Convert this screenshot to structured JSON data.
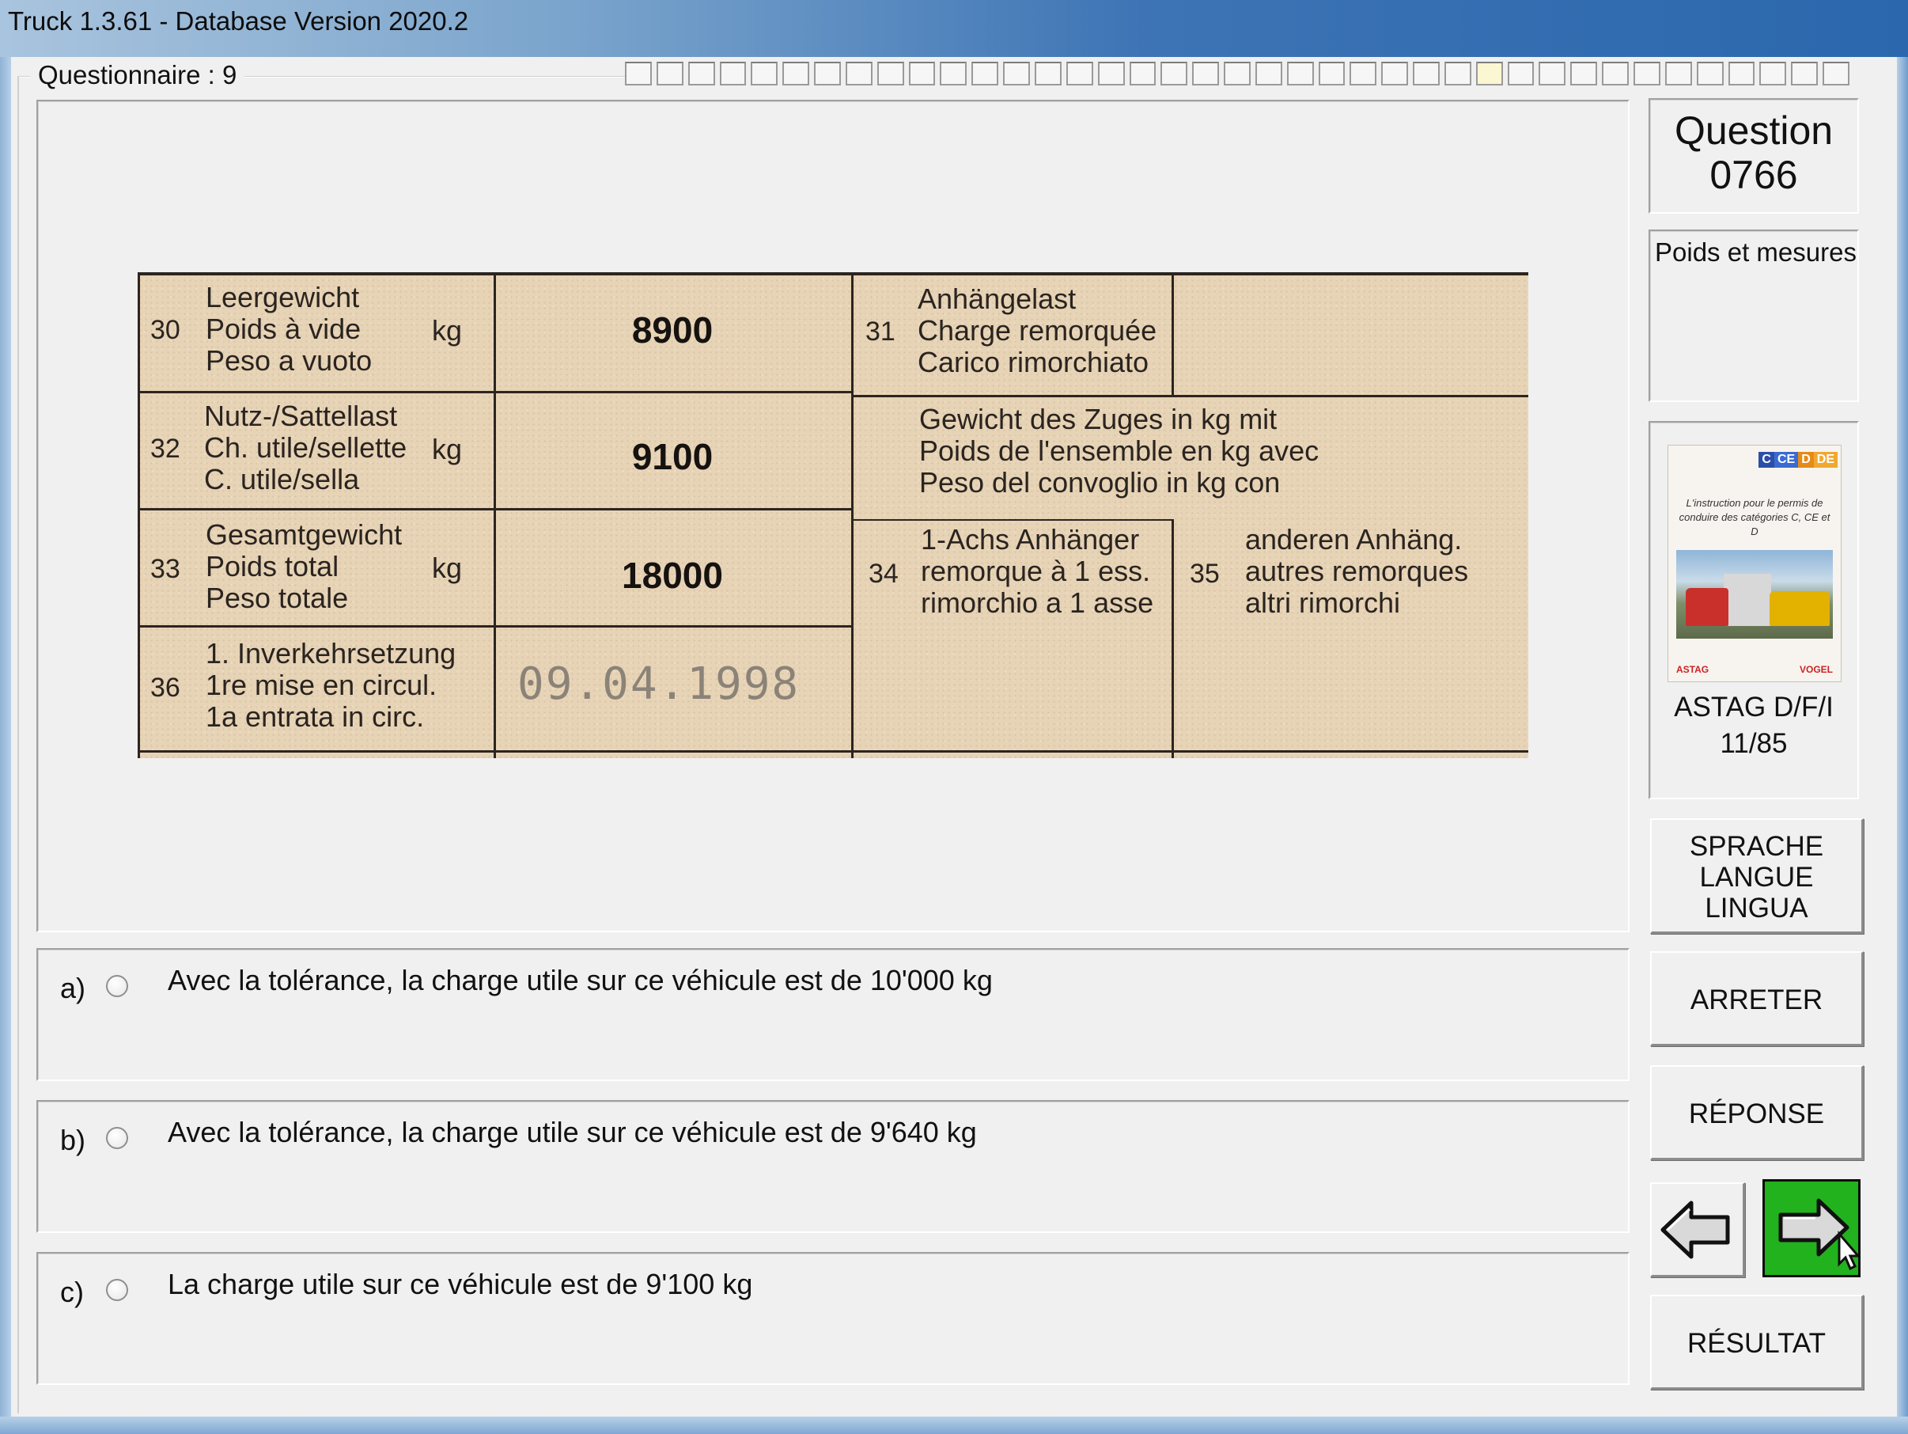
{
  "window": {
    "title": "Truck 1.3.61 - Database Version 2020.2"
  },
  "questionnaire": {
    "label": "Questionnaire : 9",
    "progress_total": 39,
    "progress_current": 28
  },
  "question": {
    "label": "Question",
    "number": "0766",
    "category": "Poids et mesures"
  },
  "document": {
    "rows": [
      {
        "num": "30",
        "lines": [
          "Leergewicht",
          "Poids à vide",
          "Peso a vuoto"
        ],
        "unit": "kg",
        "value": "8900"
      },
      {
        "num": "32",
        "lines": [
          "Nutz-/Sattellast",
          "Ch. utile/sellette",
          "C. utile/sella"
        ],
        "unit": "kg",
        "value": "9100"
      },
      {
        "num": "33",
        "lines": [
          "Gesamtgewicht",
          "Poids total",
          "Peso totale"
        ],
        "unit": "kg",
        "value": "18000"
      },
      {
        "num": "36",
        "lines": [
          "1. Inverkehrsetzung",
          "1re mise en circul.",
          "1a entrata in circ."
        ],
        "unit": "",
        "value": "09.04.1998"
      }
    ],
    "field31": {
      "num": "31",
      "lines": [
        "Anhängelast",
        "Charge remorquée",
        "Carico rimorchiato"
      ]
    },
    "combination": {
      "lines": [
        "Gewicht des Zuges in kg mit",
        "Poids de l'ensemble en kg avec",
        "Peso del convoglio in kg con"
      ]
    },
    "field34": {
      "num": "34",
      "lines": [
        "1-Achs Anhänger",
        "remorque à 1 ess.",
        "rimorchio a 1 asse"
      ]
    },
    "field35": {
      "num": "35",
      "lines": [
        "anderen Anhäng.",
        "autres remorques",
        "altri rimorchi"
      ]
    }
  },
  "answers": [
    {
      "letter": "a)",
      "text": "Avec la tolérance, la charge utile sur ce véhicule est de 10'000 kg",
      "selected": false
    },
    {
      "letter": "b)",
      "text": "Avec la tolérance, la charge utile sur ce véhicule est de 9'640 kg",
      "selected": false
    },
    {
      "letter": "c)",
      "text": "La charge utile sur ce véhicule est de 9'100 kg",
      "selected": false
    }
  ],
  "book": {
    "badges": [
      "C",
      "CE",
      "D",
      "DE"
    ],
    "cover_text": "L'instruction pour le permis de conduire des catégories C, CE et D",
    "publisher_left": "ASTAG",
    "publisher_right": "VOGEL",
    "title": "ASTAG D/F/I",
    "reference": "11/85"
  },
  "buttons": {
    "language": [
      "SPRACHE",
      "LANGUE",
      "LINGUA"
    ],
    "stop": "ARRETER",
    "answer": "RÉPONSE",
    "result": "RÉSULTAT",
    "prev_icon": "arrow-left-icon",
    "next_icon": "arrow-right-icon"
  },
  "colors": {
    "next_button": "#22b21e",
    "scan_paper": "#e7d3b5"
  }
}
